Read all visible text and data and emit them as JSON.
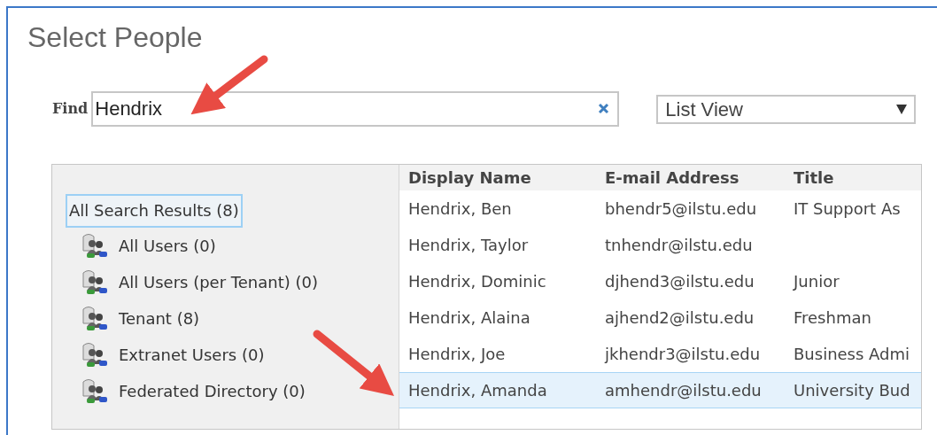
{
  "window": {
    "title": "Select People"
  },
  "find": {
    "label": "Find",
    "value": "Hendrix"
  },
  "view_select": {
    "value": "List View"
  },
  "sources": [
    {
      "label": "All Search Results (8)",
      "selected": true,
      "children": [
        {
          "label": "All Users (0)",
          "selected": false
        },
        {
          "label": "All Users (per Tenant) (0)",
          "selected": false
        },
        {
          "label": "Tenant (8)",
          "selected": false
        },
        {
          "label": "Extranet Users (0)",
          "selected": false
        },
        {
          "label": "Federated Directory (0)",
          "selected": false
        }
      ]
    }
  ],
  "table": {
    "columns": [
      "Display Name",
      "E-mail Address",
      "Title"
    ],
    "rows": [
      {
        "cells": [
          "Hendrix, Ben",
          "bhendr5@ilstu.edu",
          "IT Support As"
        ],
        "selected": false
      },
      {
        "cells": [
          "Hendrix, Taylor",
          "tnhendr@ilstu.edu",
          ""
        ],
        "selected": false
      },
      {
        "cells": [
          "Hendrix, Dominic",
          "djhend3@ilstu.edu",
          "Junior"
        ],
        "selected": false
      },
      {
        "cells": [
          "Hendrix, Alaina",
          "ajhend2@ilstu.edu",
          "Freshman"
        ],
        "selected": false
      },
      {
        "cells": [
          "Hendrix, Joe",
          "jkhendr3@ilstu.edu",
          "Business Admi"
        ],
        "selected": false
      },
      {
        "cells": [
          "Hendrix, Amanda",
          "amhendr@ilstu.edu",
          "University Bud"
        ],
        "selected": true
      }
    ]
  }
}
